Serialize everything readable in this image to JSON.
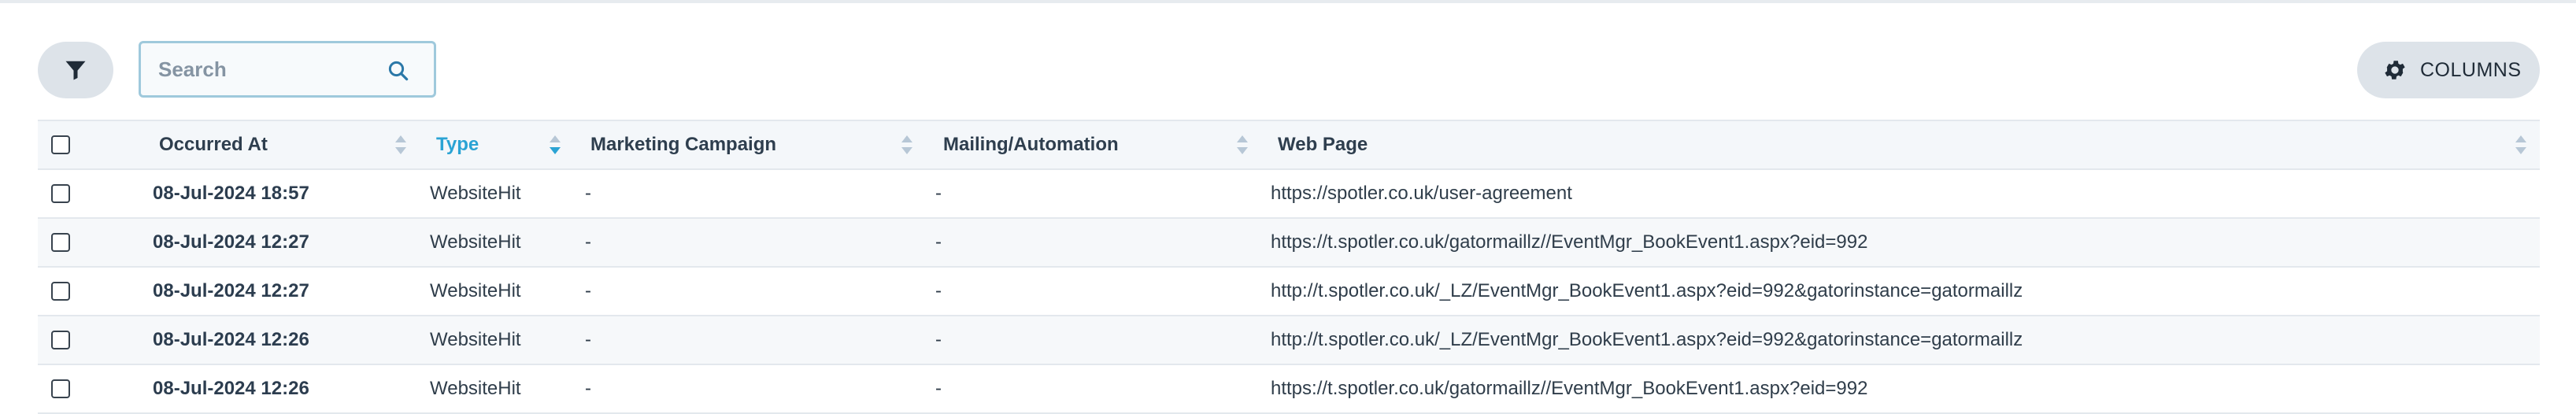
{
  "toolbar": {
    "search_placeholder": "Search",
    "columns_label": "COLUMNS"
  },
  "table": {
    "headers": {
      "occurred_at": "Occurred At",
      "type": "Type",
      "campaign": "Marketing Campaign",
      "mailing": "Mailing/Automation",
      "web_page": "Web Page"
    },
    "active_sort_column": "Type",
    "rows": [
      {
        "occurred_at": "08-Jul-2024 18:57",
        "type": "WebsiteHit",
        "campaign": "-",
        "mailing": "-",
        "web_page": "https://spotler.co.uk/user-agreement"
      },
      {
        "occurred_at": "08-Jul-2024 12:27",
        "type": "WebsiteHit",
        "campaign": "-",
        "mailing": "-",
        "web_page": "https://t.spotler.co.uk/gatormaillz//EventMgr_BookEvent1.aspx?eid=992"
      },
      {
        "occurred_at": "08-Jul-2024 12:27",
        "type": "WebsiteHit",
        "campaign": "-",
        "mailing": "-",
        "web_page": "http://t.spotler.co.uk/_LZ/EventMgr_BookEvent1.aspx?eid=992&gatorinstance=gatormaillz"
      },
      {
        "occurred_at": "08-Jul-2024 12:26",
        "type": "WebsiteHit",
        "campaign": "-",
        "mailing": "-",
        "web_page": "http://t.spotler.co.uk/_LZ/EventMgr_BookEvent1.aspx?eid=992&gatorinstance=gatormaillz"
      },
      {
        "occurred_at": "08-Jul-2024 12:26",
        "type": "WebsiteHit",
        "campaign": "-",
        "mailing": "-",
        "web_page": "https://t.spotler.co.uk/gatormaillz//EventMgr_BookEvent1.aspx?eid=992"
      }
    ]
  },
  "colors": {
    "accent": "#2aa3d4",
    "button_bg": "#dde3e9",
    "header_bg": "#f4f7fa"
  },
  "icons": {
    "filter": "filter-icon",
    "search": "search-icon",
    "columns": "gear-icon",
    "sort": "sort-icon"
  }
}
